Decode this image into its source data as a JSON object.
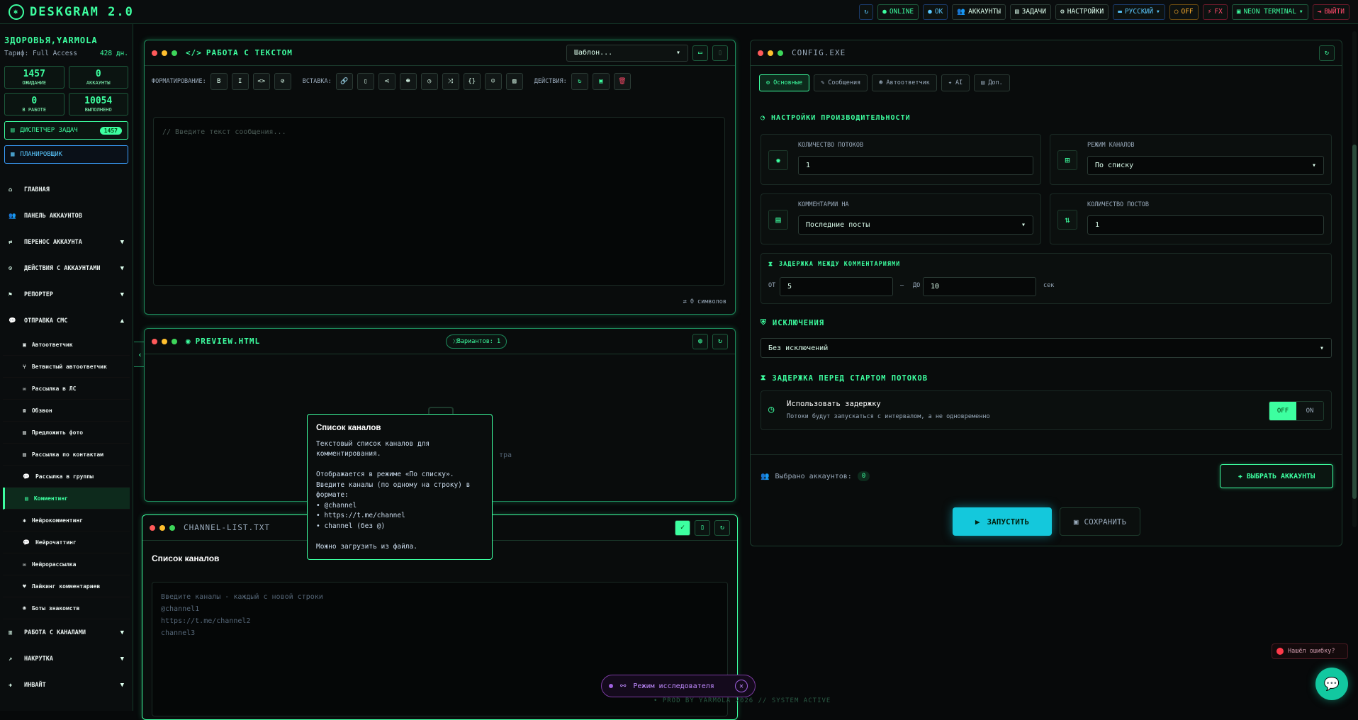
{
  "app": {
    "title": "DESKGRAM 2.0"
  },
  "topbar": {
    "status_online": "ONLINE",
    "status_ok": "OK",
    "accounts": "АККАУНТЫ",
    "tasks": "ЗАДАЧИ",
    "settings": "НАСТРОЙКИ",
    "language": "РУССКИЙ",
    "off": "OFF",
    "fx": "FX",
    "theme": "NEON TERMINAL",
    "logout": "ВЫЙТИ"
  },
  "user": {
    "name": "ЗДОРОВЬЯ,YARMOLA",
    "tariff": "Тариф: Full Access",
    "days": "428 дн."
  },
  "stats": [
    {
      "value": "1457",
      "label": "ОЖИДАНИЕ"
    },
    {
      "value": "0",
      "label": "АККАУНТЫ"
    },
    {
      "value": "0",
      "label": "В РАБОТЕ"
    },
    {
      "value": "10054",
      "label": "ВЫПОЛНЕНО"
    }
  ],
  "dispatcher": {
    "label": "ДИСПЕТЧЕР ЗАДАЧ",
    "count": "1457"
  },
  "scheduler": {
    "label": "ПЛАНИРОВЩИК"
  },
  "nav": {
    "home": "ГЛАВНАЯ",
    "accounts_panel": "ПАНЕЛЬ АККАУНТОВ",
    "transfer": "ПЕРЕНОС АККАУНТА",
    "actions": "ДЕЙСТВИЯ С АККАУНТАМИ",
    "reporter": "РЕПОРТЕР",
    "send": "ОТПРАВКА СМС",
    "sub": [
      "Автоответчик",
      "Ветвистый автоответчик",
      "Рассылка в ЛС",
      "Обзвон",
      "Предложить фото",
      "Рассылка по контактам",
      "Рассылка в группы",
      "Комментинг",
      "Нейрокомментинг",
      "Нейрочаттинг",
      "Нейрорассылка",
      "Лайкинг комментариев",
      "Боты знакомств"
    ],
    "channels": "РАБОТА С КАНАЛАМИ",
    "boost": "НАКРУТКА",
    "invite": "ИНВАЙТ"
  },
  "editor": {
    "title": "РАБОТА С ТЕКСТОМ",
    "template": "Шаблон...",
    "fmt_label": "ФОРМАТИРОВАНИЕ:",
    "ins_label": "ВСТАВКА:",
    "act_label": "ДЕЙСТВИЯ:",
    "placeholder": "// Введите текст сообщения...",
    "chars": "0 символов"
  },
  "preview": {
    "title": "PREVIEW.HTML",
    "variants": "Вариантов: 1",
    "empty": "тра"
  },
  "channels_panel": {
    "title": "CHANNEL-LIST.TXT",
    "heading": "Список каналов",
    "placeholder": "Введите каналы - каждый с новой строки\n@channel1\nhttps://t.me/channel2\nchannel3"
  },
  "tooltip": {
    "title": "Список каналов",
    "body": "Текстовый список каналов для комментирования.\n\nОтображается в режиме «По списку». Введите каналы (по одному на строку) в формате:\n• @channel\n• https://t.me/channel\n• channel (без @)\n\nМожно загрузить из файла."
  },
  "config": {
    "title": "CONFIG.EXE",
    "tabs": [
      "Основные",
      "Сообщения",
      "Автоответчик",
      "AI",
      "Доп."
    ],
    "perf_section": "НАСТРОЙКИ ПРОИЗВОДИТЕЛЬНОСТИ",
    "threads_label": "КОЛИЧЕСТВО ПОТОКОВ",
    "threads_value": "1",
    "channel_mode_label": "РЕЖИМ КАНАЛОВ",
    "channel_mode_value": "По списку",
    "comments_on_label": "КОММЕНТАРИИ НА",
    "comments_on_value": "Последние посты",
    "posts_count_label": "КОЛИЧЕСТВО ПОСТОВ",
    "posts_count_value": "1",
    "delay_label": "ЗАДЕРЖКА МЕЖДУ КОММЕНТАРИЯМИ",
    "from": "ОТ",
    "from_value": "5",
    "dash": "—",
    "to": "ДО",
    "to_value": "10",
    "sec": "сек",
    "exclusions": "ИСКЛЮЧЕНИЯ",
    "exclusions_value": "Без исключений",
    "start_delay": "ЗАДЕРЖКА ПЕРЕД СТАРТОМ ПОТОКОВ",
    "use_delay": "Использовать задержку",
    "use_delay_desc": "Потоки будут запускаться с интервалом, а не одновременно",
    "off": "OFF",
    "on": "ON",
    "selected_accounts": "Выбрано аккаунтов:",
    "selected_count": "0",
    "choose_accounts": "ВЫБРАТЬ АККАУНТЫ",
    "run": "ЗАПУСТИТЬ",
    "save": "СОХРАНИТЬ"
  },
  "footer": {
    "explorer": "Режим исследователя",
    "credit": "• PROD BY YARMOLA 2026 // SYSTEM ACTIVE",
    "bug": "Нашёл ошибку?"
  }
}
